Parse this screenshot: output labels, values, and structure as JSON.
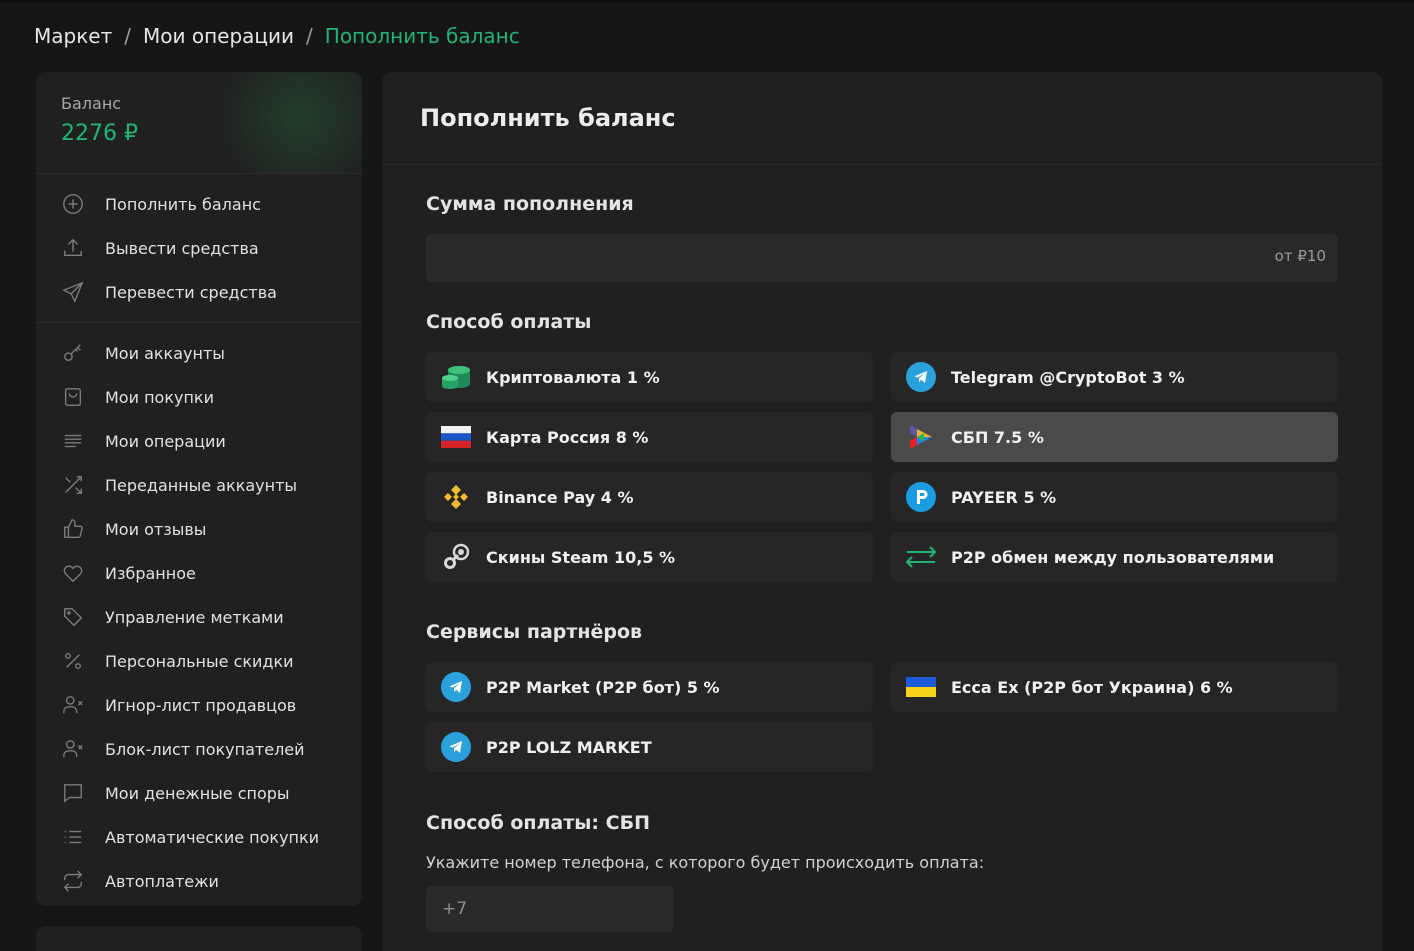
{
  "breadcrumb": {
    "item1": "Маркет",
    "item2": "Мои операции",
    "item3": "Пополнить баланс",
    "separator": "/"
  },
  "balance": {
    "label": "Баланс",
    "value": "2276 ₽"
  },
  "sidebar": {
    "items": [
      {
        "label": "Пополнить баланс",
        "icon": "plus-circle-icon"
      },
      {
        "label": "Вывести средства",
        "icon": "upload-icon"
      },
      {
        "label": "Перевести средства",
        "icon": "send-icon"
      },
      {
        "label": "Мои аккаунты",
        "icon": "key-icon"
      },
      {
        "label": "Мои покупки",
        "icon": "shopping-bag-icon"
      },
      {
        "label": "Мои операции",
        "icon": "list-icon"
      },
      {
        "label": "Переданные аккаунты",
        "icon": "shuffle-icon"
      },
      {
        "label": "Мои отзывы",
        "icon": "thumbs-up-icon"
      },
      {
        "label": "Избранное",
        "icon": "heart-icon"
      },
      {
        "label": "Управление метками",
        "icon": "tag-icon"
      },
      {
        "label": "Персональные скидки",
        "icon": "percent-icon"
      },
      {
        "label": "Игнор-лист продавцов",
        "icon": "user-x-icon"
      },
      {
        "label": "Блок-лист покупателей",
        "icon": "user-x-icon"
      },
      {
        "label": "Мои денежные споры",
        "icon": "message-square-icon"
      },
      {
        "label": "Автоматические покупки",
        "icon": "list-bullets-icon"
      },
      {
        "label": "Автоплатежи",
        "icon": "repeat-icon"
      }
    ]
  },
  "main": {
    "title": "Пополнить баланс",
    "amount_title": "Сумма пополнения",
    "amount_placeholder": "от ₽10",
    "method_title": "Способ оплаты",
    "methods": [
      {
        "label": "Криптовалюта 1 %",
        "icon": "coins-icon"
      },
      {
        "label": "Telegram @CryptoBot 3 %",
        "icon": "telegram-icon"
      },
      {
        "label": "Карта Россия 8 %",
        "icon": "russia-flag-icon"
      },
      {
        "label": "СБП 7.5 %",
        "icon": "sbp-icon",
        "selected": true
      },
      {
        "label": "Binance Pay 4 %",
        "icon": "binance-icon"
      },
      {
        "label": "PAYEER 5 %",
        "icon": "payeer-icon"
      },
      {
        "label": "Скины Steam 10,5 %",
        "icon": "steam-icon"
      },
      {
        "label": "P2P обмен между пользователями",
        "icon": "exchange-arrows-icon"
      }
    ],
    "partners_title": "Сервисы партнёров",
    "partners": [
      {
        "label": "P2P Market (P2P бот) 5 %",
        "icon": "telegram-icon"
      },
      {
        "label": "Ecca Ex (P2P бот Украина) 6 %",
        "icon": "ukraine-flag-icon"
      },
      {
        "label": "P2P LOLZ MARKET",
        "icon": "telegram-icon"
      }
    ],
    "selected_method_title": "Способ оплаты: СБП",
    "phone_hint": "Укажите номер телефона, с которого будет происходить оплата:",
    "phone_value": "+7"
  },
  "colors": {
    "accent": "#1fb674",
    "background": "#161616",
    "panel": "#202020",
    "telegram": "#2aa1da",
    "binance": "#f3ba2f",
    "payeer": "#1b9be0"
  }
}
